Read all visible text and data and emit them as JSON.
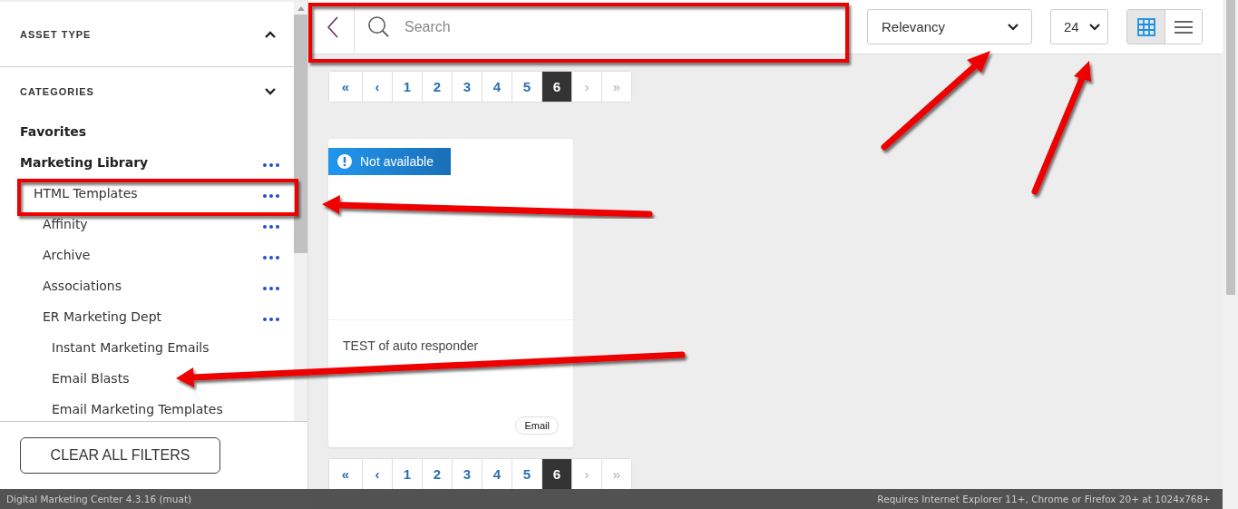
{
  "sidebar": {
    "sections": [
      {
        "title": "ASSET TYPE",
        "expanded": true
      },
      {
        "title": "CATEGORIES",
        "expanded": false
      }
    ],
    "tree": [
      {
        "label": "Favorites",
        "has_menu": false
      },
      {
        "label": "Marketing Library",
        "has_menu": true,
        "children": [
          {
            "label": "HTML Templates",
            "has_menu": true,
            "children": [
              {
                "label": "Affinity",
                "has_menu": true
              },
              {
                "label": "Archive",
                "has_menu": true
              },
              {
                "label": "Associations",
                "has_menu": true
              },
              {
                "label": "ER Marketing Dept",
                "has_menu": true,
                "children": [
                  {
                    "label": "Instant Marketing Emails",
                    "has_menu": false
                  },
                  {
                    "label": "Email Blasts",
                    "has_menu": false
                  },
                  {
                    "label": "Email Marketing Templates",
                    "has_menu": false
                  }
                ]
              }
            ]
          }
        ]
      }
    ],
    "clear_button": "CLEAR ALL FILTERS"
  },
  "toolbar": {
    "search": {
      "placeholder": "Search"
    },
    "sort": "Relevancy",
    "page_size": "24",
    "views": [
      {
        "kind": "grid",
        "selected": true
      },
      {
        "kind": "list",
        "selected": false
      }
    ]
  },
  "pagination_top": [
    {
      "label": "«",
      "selected": false,
      "disabled": false
    },
    {
      "label": "‹",
      "selected": false,
      "disabled": false
    },
    {
      "label": "1",
      "selected": false,
      "disabled": false
    },
    {
      "label": "2",
      "selected": false,
      "disabled": false
    },
    {
      "label": "3",
      "selected": false,
      "disabled": false
    },
    {
      "label": "4",
      "selected": false,
      "disabled": false
    },
    {
      "label": "5",
      "selected": false,
      "disabled": false
    },
    {
      "label": "6",
      "selected": true,
      "disabled": false
    },
    {
      "label": "›",
      "selected": false,
      "disabled": true
    },
    {
      "label": "»",
      "selected": false,
      "disabled": true
    }
  ],
  "cards": [
    {
      "badge": "Not available",
      "title": "TEST of auto responder",
      "tag": "Email"
    }
  ],
  "pagination_bottom": [
    {
      "label": "«",
      "selected": false,
      "disabled": false
    },
    {
      "label": "‹",
      "selected": false,
      "disabled": false
    },
    {
      "label": "1",
      "selected": false,
      "disabled": false
    },
    {
      "label": "2",
      "selected": false,
      "disabled": false
    },
    {
      "label": "3",
      "selected": false,
      "disabled": false
    },
    {
      "label": "4",
      "selected": false,
      "disabled": false
    },
    {
      "label": "5",
      "selected": false,
      "disabled": false
    },
    {
      "label": "6",
      "selected": true,
      "disabled": false
    },
    {
      "label": "›",
      "selected": false,
      "disabled": true
    },
    {
      "label": "»",
      "selected": false,
      "disabled": true
    }
  ],
  "status_bar": {
    "left": "Digital Marketing Center 4.3.16 (muat)",
    "right": "Requires Internet Explorer 11+, Chrome or Firefox 20+ at 1024x768+"
  }
}
